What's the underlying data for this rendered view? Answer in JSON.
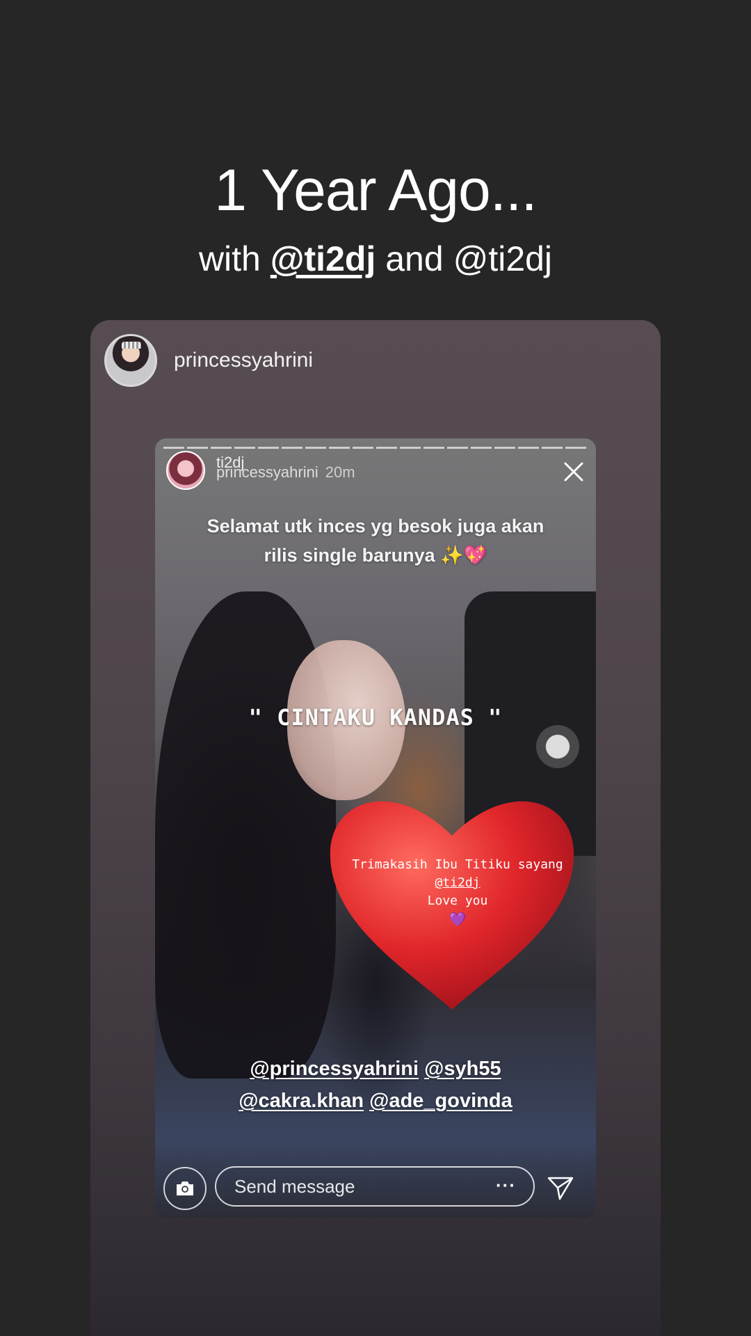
{
  "memory": {
    "title": "1 Year Ago...",
    "with_label": "with",
    "mention_primary": "@ti2dj",
    "and_label": "and",
    "mention_secondary": "@ti2dj"
  },
  "card": {
    "username": "princessyahrini",
    "story": {
      "overlay_username_top": "ti2dj",
      "overlay_username": "princessyahrini",
      "time": "20m",
      "caption_line1": "Selamat utk inces yg besok juga akan",
      "caption_line2": "rilis single barunya ✨💖",
      "song_title": "\" CINTAKU KANDAS \"",
      "heart_line1": "Trimakasih Ibu Titiku sayang",
      "heart_mention": "@ti2dj",
      "heart_line3": "Love you",
      "heart_emoji": "💜",
      "mention_1": "@princessyahrini",
      "mention_2": "@syh55",
      "mention_3": "@cakra.khan",
      "mention_4": "@ade_govinda",
      "message_placeholder": "Send message",
      "more_label": "···"
    }
  },
  "colors": {
    "background": "#262626",
    "card_top": "#574c52",
    "heart_red": "#e0262a"
  }
}
